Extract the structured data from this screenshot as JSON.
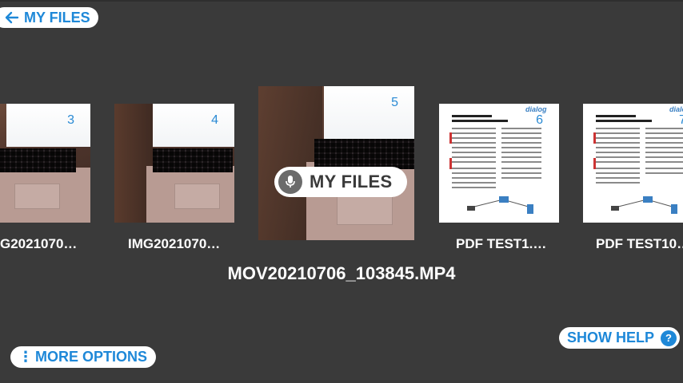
{
  "header": {
    "back_label": "MY FILES"
  },
  "gallery": {
    "items": [
      {
        "number": "3",
        "caption": "G2021070…",
        "kind": "photo"
      },
      {
        "number": "4",
        "caption": "IMG2021070…",
        "kind": "photo"
      },
      {
        "number": "5",
        "caption": "",
        "kind": "video"
      },
      {
        "number": "6",
        "caption": "PDF TEST1.…",
        "kind": "pdf"
      },
      {
        "number": "7",
        "caption": "PDF TEST10…",
        "kind": "pdf"
      }
    ],
    "selected_caption": "MOV20210706_103845.MP4"
  },
  "voice_badge": {
    "label": "MY FILES",
    "icon": "microphone-icon"
  },
  "footer": {
    "more_options_label": "MORE OPTIONS",
    "show_help_label": "SHOW HELP",
    "help_icon_glyph": "?"
  },
  "colors": {
    "background": "#3a3a3a",
    "accent": "#1e88d8",
    "number": "#2a8ad4"
  }
}
